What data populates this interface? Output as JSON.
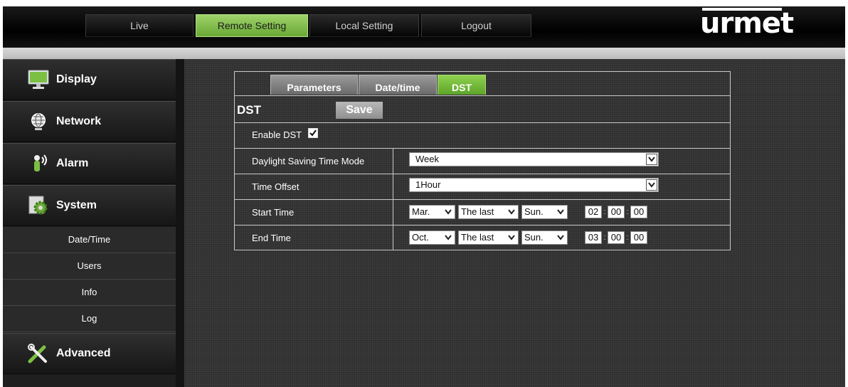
{
  "topnav": {
    "items": [
      {
        "label": "Live"
      },
      {
        "label": "Remote Setting"
      },
      {
        "label": "Local Setting"
      },
      {
        "label": "Logout"
      }
    ],
    "active_index": 1,
    "logo": "urmet"
  },
  "sidebar": {
    "categories": [
      {
        "label": "Display",
        "icon": "monitor-icon"
      },
      {
        "label": "Network",
        "icon": "globe-icon"
      },
      {
        "label": "Alarm",
        "icon": "alarm-icon"
      },
      {
        "label": "System",
        "icon": "gear-icon"
      },
      {
        "label": "Advanced",
        "icon": "tools-icon"
      }
    ],
    "system_items": [
      {
        "label": "Date/Time"
      },
      {
        "label": "Users"
      },
      {
        "label": "Info"
      },
      {
        "label": "Log"
      }
    ]
  },
  "tabs": [
    {
      "label": "Parameters"
    },
    {
      "label": "Date/time"
    },
    {
      "label": "DST"
    }
  ],
  "active_tab": "DST",
  "section_title": "DST",
  "save_label": "Save",
  "form": {
    "enable_dst": {
      "label": "Enable DST",
      "checked": true
    },
    "mode": {
      "label": "Daylight Saving Time Mode",
      "value": "Week"
    },
    "offset": {
      "label": "Time Offset",
      "value": "1Hour"
    },
    "start": {
      "label": "Start Time",
      "month": "Mar.",
      "week": "The last",
      "day": "Sun.",
      "hour": "02",
      "minute": "00",
      "second": "00"
    },
    "end": {
      "label": "End Time",
      "month": "Oct.",
      "week": "The last",
      "day": "Sun.",
      "hour": "03",
      "minute": "00",
      "second": "00"
    }
  },
  "colors": {
    "accent_green": "#7bc043",
    "background": "#303030",
    "sidebar": "#1f1f1f",
    "panel_border": "#c8c8c8"
  }
}
